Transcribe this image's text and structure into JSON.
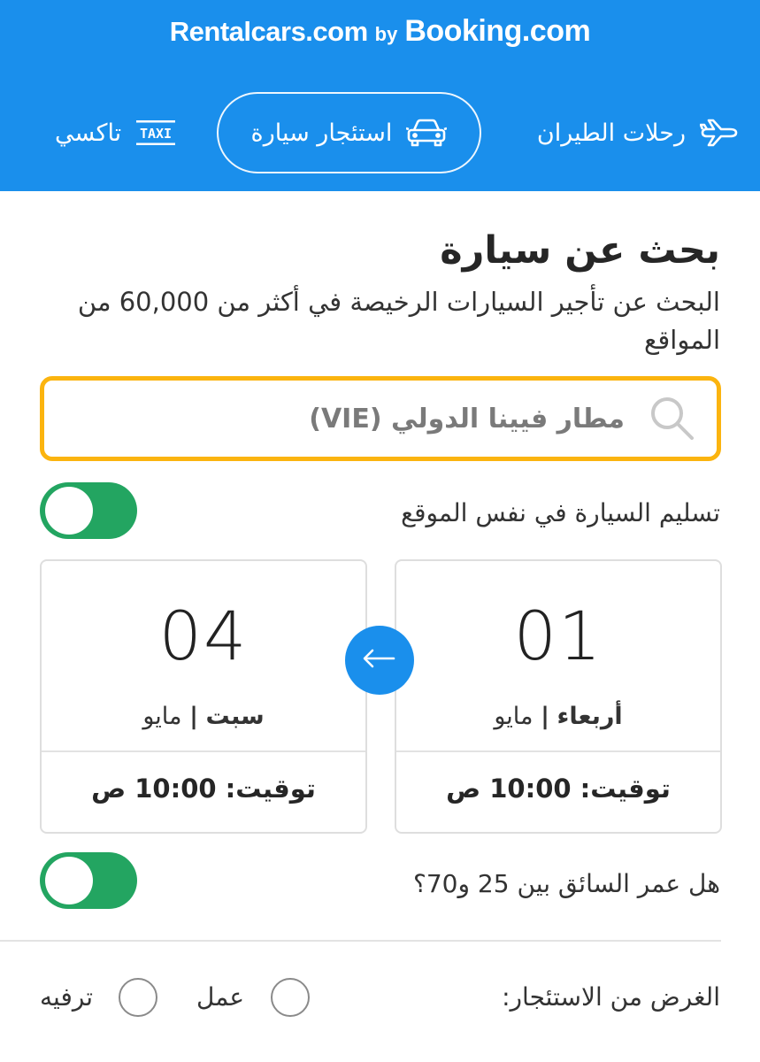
{
  "brand": {
    "part1": "Rentalcars.com",
    "part2": "by",
    "part3": "Booking.com"
  },
  "nav": {
    "flights": {
      "label": "رحلات الطيران",
      "icon": "plane-icon"
    },
    "car": {
      "label": "استئجار سيارة",
      "icon": "car-icon",
      "active": true
    },
    "taxi": {
      "label": "تاكسي",
      "icon": "taxi-icon",
      "icon_text": "TAXI"
    }
  },
  "search": {
    "title": "بحث عن سيارة",
    "subtitle": "البحث عن تأجير السيارات الرخيصة في أكثر من 60,000 من المواقع",
    "location_value": "مطار فيينا الدولي (VIE)",
    "search_icon": "search-icon"
  },
  "same_location": {
    "label": "تسليم السيارة في نفس الموقع",
    "on": true
  },
  "pickup": {
    "day": "01",
    "weekday": "أربعاء",
    "month": "مايو",
    "separator": "|",
    "time": "توقيت: 10:00 ص"
  },
  "dropoff": {
    "day": "04",
    "weekday": "سبت",
    "month": "مايو",
    "separator": "|",
    "time": "توقيت: 10:00 ص"
  },
  "driver_age": {
    "label": "هل عمر السائق بين 25 و70؟",
    "on": true
  },
  "purpose": {
    "label": "الغرض من الاستئجار:",
    "options": [
      "عمل",
      "ترفيه"
    ]
  },
  "colors": {
    "header": "#1a8fec",
    "search_border": "#fbb40f",
    "toggle_on": "#23a561"
  }
}
